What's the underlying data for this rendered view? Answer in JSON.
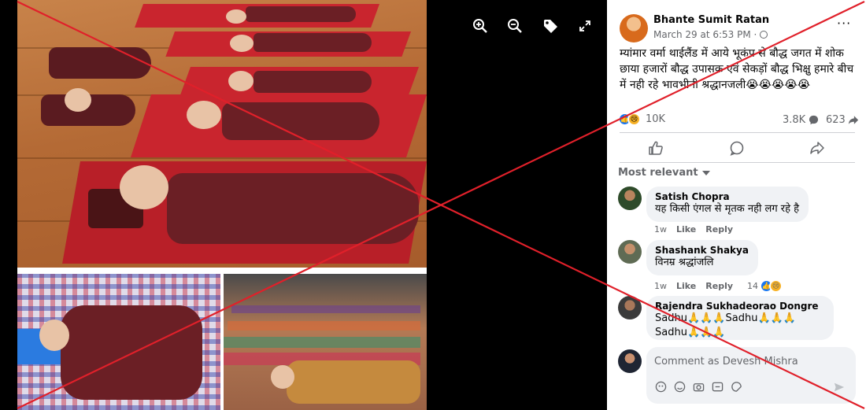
{
  "viewer": {
    "toolbar": [
      {
        "name": "zoom-in-icon"
      },
      {
        "name": "zoom-out-icon"
      },
      {
        "name": "tag-icon"
      },
      {
        "name": "fullscreen-icon"
      }
    ]
  },
  "post": {
    "author": "Bhante Sumit Ratan",
    "time": "March 29 at 6:53 PM · ",
    "privacy_icon": "globe-icon",
    "more_label": "···",
    "text": "म्यांमार वर्मा थाईलैंड में आये भूकंप से बौद्ध जगत में शोक छाया हजारों बौद्ध उपासक एवं सेकड़ों बौद्ध भिक्षु हमारे बीच में नही रहे भावभीनी श्रद्धानजली😭😭😭😭😭",
    "reaction_count": "10K",
    "comment_count": "3.8K",
    "share_count": "623",
    "actions": [
      "like-icon",
      "comment-icon",
      "share-icon"
    ],
    "sort_label": "Most relevant"
  },
  "comments": [
    {
      "name": "Satish Chopra",
      "text": "यह किसी एंगल से मृतक नही लग रहे है",
      "time": "1w",
      "like": "Like",
      "reply": "Reply",
      "reactions": ""
    },
    {
      "name": "Shashank Shakya",
      "text": "विनम्र श्रद्धांजलि",
      "time": "1w",
      "like": "Like",
      "reply": "Reply",
      "reactions": "14"
    },
    {
      "name": "Rajendra Sukhadeorao Dongre",
      "text": "Sadhu🙏🙏🙏Sadhu🙏🙏🙏",
      "text2": "Sadhu🙏🙏🙏"
    }
  ],
  "composer": {
    "placeholder": "Comment as Devesh Mishra",
    "icons": [
      "avatar-sticker-icon",
      "emoji-icon",
      "camera-icon",
      "gif-icon",
      "sticker-icon"
    ]
  },
  "colors": {
    "accent": "#1877f2",
    "secondary_text": "#65676b",
    "bubble": "#f0f2f5",
    "cross": "#e0202a"
  }
}
